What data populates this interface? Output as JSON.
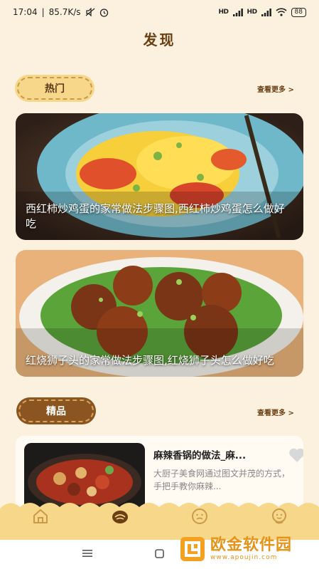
{
  "status_bar": {
    "time": "17:04",
    "network_speed": "85.7K/s",
    "signal_1": "HD",
    "signal_2": "HD",
    "battery": "88"
  },
  "page_title": "发现",
  "sections": {
    "hot": {
      "label": "热门",
      "more": "查看更多 >"
    },
    "featured": {
      "label": "精品",
      "more": "查看更多 >"
    }
  },
  "hot_cards": [
    {
      "caption": "西红柿炒鸡蛋的家常做法步骤图,西红柿炒鸡蛋怎么做好吃"
    },
    {
      "caption": "红烧狮子头的家常做法步骤图,红烧狮子头怎么做好吃"
    }
  ],
  "featured_items": [
    {
      "title": "麻辣香锅的做法_麻...",
      "desc": "大厨子美食网通过图文并茂的方式，手把手教你麻辣..."
    }
  ],
  "tabs": [
    {
      "icon": "home-icon"
    },
    {
      "icon": "discover-icon"
    },
    {
      "icon": "face-icon"
    },
    {
      "icon": "profile-icon"
    }
  ],
  "watermark": {
    "brand": "欧金软件园",
    "url": "www.apoujin.com"
  },
  "colors": {
    "background": "#fcf1de",
    "accent": "#8a5520",
    "badge": "#f7d78a",
    "watermark": "#e69318"
  }
}
